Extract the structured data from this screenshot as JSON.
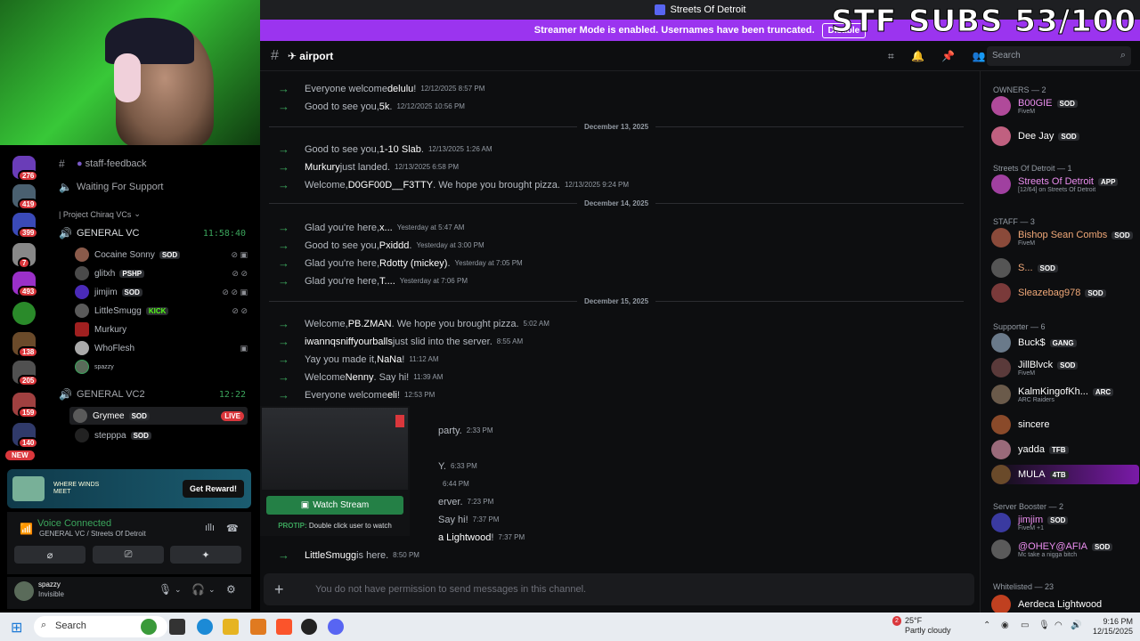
{
  "window": {
    "title": "Streets Of Detroit"
  },
  "banner": {
    "text": "Streamer Mode is enabled. Usernames have been truncated.",
    "disable_label": "Disable"
  },
  "overlay": {
    "subs_text": "STF SUBS 53/100"
  },
  "rail": {
    "badges": [
      "276",
      "419",
      "399",
      "7",
      "493",
      "138",
      "205",
      "159",
      "140"
    ],
    "new_label": "NEW"
  },
  "channels": {
    "staff_feedback": "staff-feedback",
    "waiting_support": "Waiting For Support",
    "category": "| Project Chiraq VCs",
    "general_vc": {
      "name": "GENERAL VC",
      "time": "11:58:40"
    },
    "general_vc_users": [
      {
        "name": "Cocaine Sonny",
        "tag": "SOD"
      },
      {
        "name": "glitxh",
        "tag": "PSHP"
      },
      {
        "name": "jimjim",
        "tag": "SOD"
      },
      {
        "name": "LittleSmugg",
        "tag": "KICK"
      },
      {
        "name": "Murkury",
        "tag": ""
      },
      {
        "name": "WhoFlesh",
        "tag": ""
      },
      {
        "name": "spazzy",
        "tag": ""
      }
    ],
    "general_vc2": {
      "name": "GENERAL VC2",
      "time": "12:22"
    },
    "general_vc2_users": [
      {
        "name": "Grymee",
        "tag": "SOD",
        "live": "LIVE"
      },
      {
        "name": "stepppa",
        "tag": "SOD"
      }
    ]
  },
  "reward": {
    "text": "WHERE WINDS MEET",
    "button": "Get Reward!"
  },
  "voice": {
    "title": "Voice Connected",
    "subtitle": "GENERAL VC / Streets Of Detroit"
  },
  "user": {
    "name": "spazzy",
    "status": "Invisible"
  },
  "chat": {
    "channel_name": "airport",
    "search_placeholder": "Search",
    "composer_placeholder": "You do not have permission to send messages in this channel.",
    "separators": [
      "December 13, 2025",
      "December 14, 2025",
      "December 15, 2025"
    ],
    "messages": [
      {
        "pre": "Everyone welcome ",
        "user": "delulu",
        "post": "!",
        "time": "12/12/2025 8:57 PM"
      },
      {
        "pre": "Good to see you, ",
        "user": "5k",
        "post": ".",
        "time": "12/12/2025 10:56 PM"
      },
      {
        "pre": "Good to see you, ",
        "user": "1-10 Slab",
        "post": ".",
        "time": "12/13/2025 1:26 AM"
      },
      {
        "pre": "",
        "user": "Murkury",
        "post": " just landed.",
        "time": "12/13/2025 6:58 PM"
      },
      {
        "pre": "Welcome, ",
        "user": "D0GF00D__F3TTY",
        "post": ". We hope you brought pizza.",
        "time": "12/13/2025 9:24 PM"
      },
      {
        "pre": "Glad you're here, ",
        "user": "x...",
        "post": "",
        "time": "Yesterday at 5:47 AM"
      },
      {
        "pre": "Good to see you, ",
        "user": "Pxiddd",
        "post": ".",
        "time": "Yesterday at 3:00 PM"
      },
      {
        "pre": "Glad you're here, ",
        "user": "Rdotty (mickey)",
        "post": ".",
        "time": "Yesterday at 7:05 PM"
      },
      {
        "pre": "Glad you're here, ",
        "user": "T....",
        "post": "",
        "time": "Yesterday at 7:06 PM"
      },
      {
        "pre": "Welcome, ",
        "user": "PB.ZMAN",
        "post": " . We hope you brought pizza.",
        "time": "5:02 AM"
      },
      {
        "pre": "",
        "user": "iwannqsniffyourballs",
        "post": " just slid into the server.",
        "time": "8:55 AM"
      },
      {
        "pre": "Yay you made it, ",
        "user": "NaNa",
        "post": "!",
        "time": "11:12 AM"
      },
      {
        "pre": "Welcome ",
        "user": "Nenny",
        "post": ". Say hi!",
        "time": "11:39 AM"
      },
      {
        "pre": "Everyone welcome ",
        "user": "eli",
        "post": "!",
        "time": "12:53 PM"
      },
      {
        "pre": "",
        "user": "",
        "post": "party.",
        "time": "2:33 PM"
      },
      {
        "pre": "",
        "user": "",
        "post": "Y.",
        "time": "6:33 PM"
      },
      {
        "pre": "",
        "user": "",
        "post": "",
        "time": "6:44 PM"
      },
      {
        "pre": "",
        "user": "",
        "post": "erver.",
        "time": "7:23 PM"
      },
      {
        "pre": "",
        "user": "",
        "post": "Say hi!",
        "time": "7:37 PM"
      },
      {
        "pre": "",
        "user": "a Lightwood",
        "post": "!",
        "time": "7:37 PM"
      },
      {
        "pre": "",
        "user": "LittleSmugg",
        "post": " is here.",
        "time": "8:50 PM"
      }
    ]
  },
  "popup": {
    "watch_label": "Watch Stream",
    "protip_label": "PROTIP:",
    "protip_text": " Double click user to watch"
  },
  "members": {
    "owners": "OWNERS — 2",
    "owner_list": [
      {
        "name": "B00GIE",
        "tag": "SOD",
        "sub": "FiveM",
        "color": "#ec8ef0"
      },
      {
        "name": "Dee Jay",
        "tag": "SOD",
        "sub": "",
        "color": "#ffffff"
      }
    ],
    "sod_header": "Streets Of Detroit — 1",
    "sod_list": [
      {
        "name": "Streets Of Detroit",
        "tag": "APP",
        "sub": "[12/64] on Streets Of Detroit",
        "color": "#ec8ef0"
      }
    ],
    "staff": "STAFF — 3",
    "staff_list": [
      {
        "name": "Bishop Sean Combs",
        "tag": "SOD",
        "sub": "FiveM",
        "color": "#f0a878"
      },
      {
        "name": "S...",
        "tag": "SOD",
        "sub": "",
        "color": "#f0a878"
      },
      {
        "name": "Sleazebag978",
        "tag": "SOD",
        "sub": "",
        "color": "#f0a878"
      }
    ],
    "supporter": "Supporter — 6",
    "supporter_list": [
      {
        "name": "Buck$",
        "tag": "GANG",
        "sub": "",
        "color": "#ffffff"
      },
      {
        "name": "JillBlvck",
        "tag": "SOD",
        "sub": "FiveM",
        "color": "#ffffff"
      },
      {
        "name": "KalmKingofKh...",
        "tag": "ARC",
        "sub": "ARC Raiders",
        "color": "#ffffff"
      },
      {
        "name": "sincere",
        "tag": "",
        "sub": "",
        "color": "#ffffff"
      },
      {
        "name": "yadda",
        "tag": "TFB",
        "sub": "",
        "color": "#ffffff"
      },
      {
        "name": "MULA",
        "tag": "4TB",
        "sub": "",
        "color": "#ffffff"
      }
    ],
    "booster": "Server Booster — 2",
    "booster_list": [
      {
        "name": "jimjim",
        "tag": "SOD",
        "sub": "FiveM +1",
        "color": "#ec8ef0"
      },
      {
        "name": "@OHEY@AFIA",
        "tag": "SOD",
        "sub": "Mc take a nigga bitch",
        "color": "#ec8ef0"
      }
    ],
    "whitelisted": "Whitelisted — 23",
    "whitelisted_list": [
      {
        "name": "Aerdeca Lightwood",
        "tag": "",
        "sub": "",
        "color": "#ffffff"
      }
    ]
  },
  "taskbar": {
    "search": "Search",
    "weather_temp": "25°F",
    "weather_desc": "Partly cloudy",
    "weather_badge": "2",
    "time": "9:16 PM",
    "date": "12/15/2025"
  }
}
